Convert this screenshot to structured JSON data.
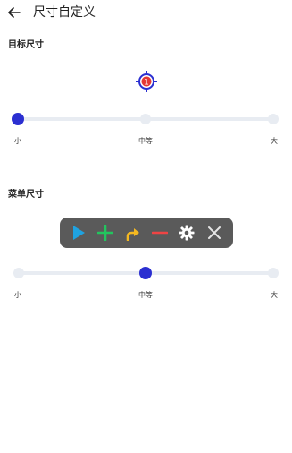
{
  "header": {
    "title": "尺寸自定义",
    "back_icon": "arrow-left-icon"
  },
  "target_section": {
    "label": "目标尺寸",
    "preview_badge": "1",
    "accent_color": "#2b2fd1",
    "badge_color": "#e53935",
    "size_value": "小",
    "ticks": [
      "小",
      "中等",
      "大"
    ]
  },
  "menu_section": {
    "label": "菜单尺寸",
    "size_value": "中等",
    "ticks": [
      "小",
      "中等",
      "大"
    ],
    "menu_icons": [
      "play-icon",
      "plus-icon",
      "swipe-arrow-icon",
      "minus-icon",
      "gear-icon",
      "close-icon"
    ],
    "menu_icon_colors": [
      "#1fa2e0",
      "#22c55e",
      "#f5b921",
      "#ef4444",
      "#ffffff",
      "#e5e5e5"
    ]
  }
}
